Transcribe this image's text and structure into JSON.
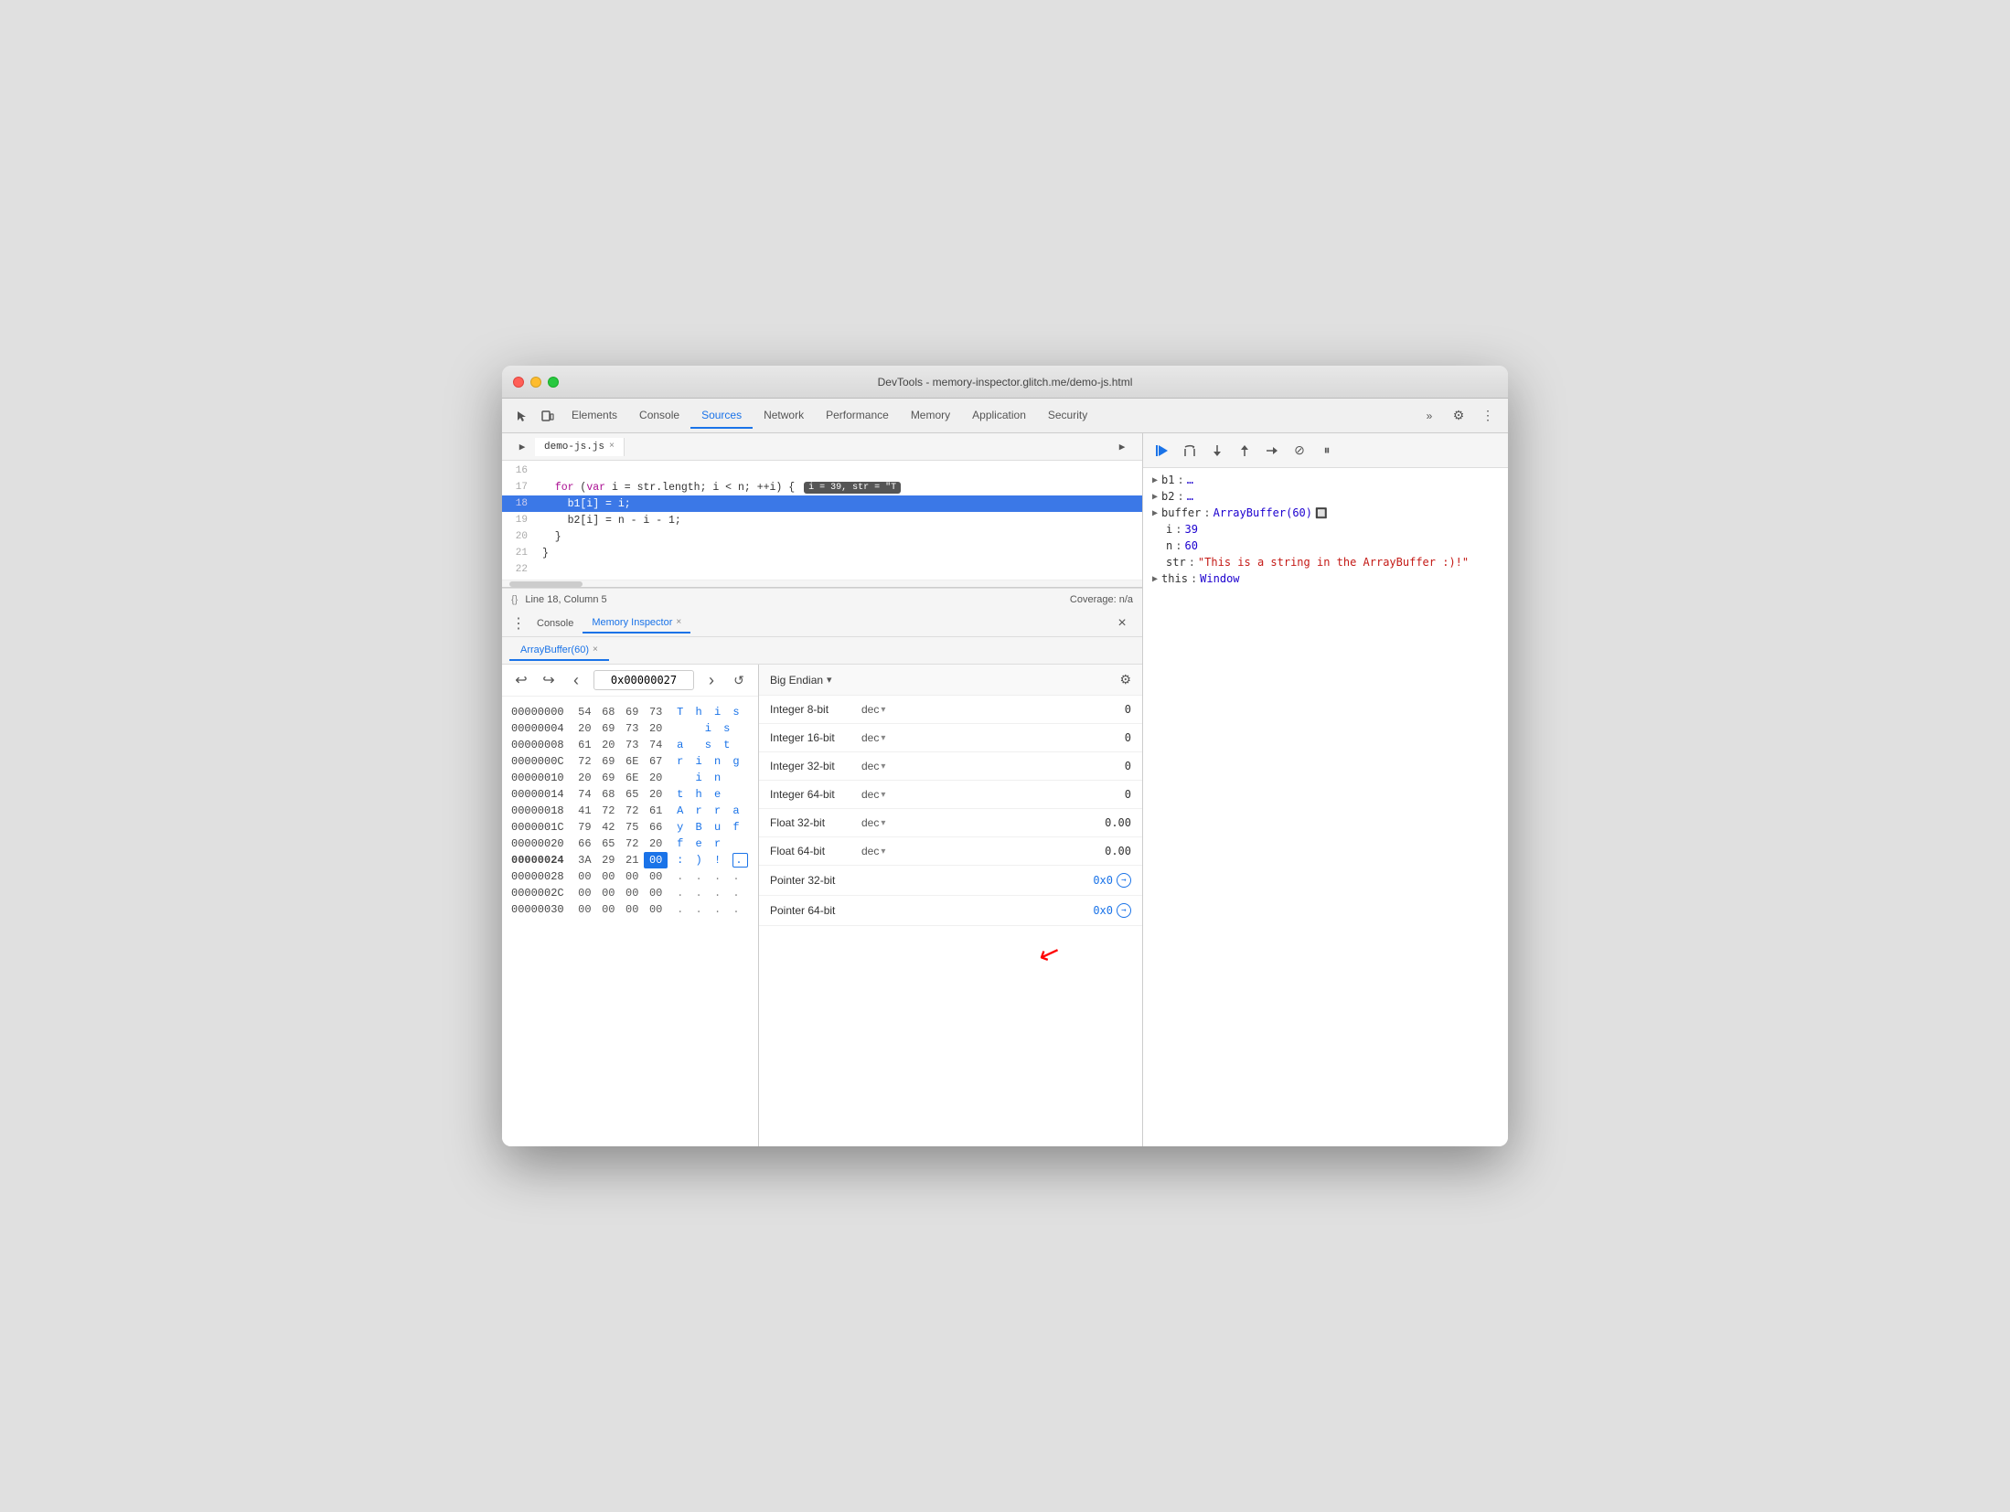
{
  "window": {
    "title": "DevTools - memory-inspector.glitch.me/demo-js.html",
    "traffic_lights": [
      "close",
      "minimize",
      "maximize"
    ]
  },
  "devtools_tabs": {
    "tabs": [
      {
        "label": "Elements",
        "active": false
      },
      {
        "label": "Console",
        "active": false
      },
      {
        "label": "Sources",
        "active": true
      },
      {
        "label": "Network",
        "active": false
      },
      {
        "label": "Performance",
        "active": false
      },
      {
        "label": "Memory",
        "active": false
      },
      {
        "label": "Application",
        "active": false
      },
      {
        "label": "Security",
        "active": false
      }
    ],
    "more_icon": "»",
    "settings_icon": "⚙",
    "menu_icon": "⋮"
  },
  "code_editor": {
    "file_tab": "demo-js.js",
    "lines": [
      {
        "num": "16",
        "text": ""
      },
      {
        "num": "17",
        "text": "  for (var i = str.length; i < n; ++i) {",
        "badge": "i = 39, str = \"T"
      },
      {
        "num": "18",
        "text": "    b1[i] = i;",
        "highlighted": true
      },
      {
        "num": "19",
        "text": "    b2[i] = n - i - 1;"
      },
      {
        "num": "20",
        "text": "  }"
      },
      {
        "num": "21",
        "text": "}"
      },
      {
        "num": "22",
        "text": ""
      }
    ],
    "status": "Line 18, Column 5",
    "coverage": "Coverage: n/a"
  },
  "debugger_toolbar": {
    "buttons": [
      {
        "name": "resume",
        "icon": "▶"
      },
      {
        "name": "step-over",
        "icon": "↪"
      },
      {
        "name": "step-into",
        "icon": "↓"
      },
      {
        "name": "step-out",
        "icon": "↑"
      },
      {
        "name": "step",
        "icon": "→"
      },
      {
        "name": "deactivate",
        "icon": "⊘"
      },
      {
        "name": "pause-exceptions",
        "icon": "⏸"
      }
    ]
  },
  "scope_panel": {
    "items": [
      {
        "key": "b1",
        "value": "…",
        "arrow": "▶",
        "indent": 0
      },
      {
        "key": "b2",
        "value": "…",
        "arrow": "▶",
        "indent": 0
      },
      {
        "key": "buffer",
        "value": "ArrayBuffer(60)",
        "arrow": "▶",
        "indent": 0,
        "has_icon": true
      },
      {
        "key": "i",
        "value": "39",
        "indent": 0,
        "no_arrow": true
      },
      {
        "key": "n",
        "value": "60",
        "indent": 0,
        "no_arrow": true
      },
      {
        "key": "str",
        "value": "\"This is a string in the ArrayBuffer :)!\"",
        "indent": 0,
        "no_arrow": true,
        "is_string": true
      },
      {
        "key": "this",
        "value": "Window",
        "arrow": "▶",
        "indent": 0
      }
    ]
  },
  "bottom_tabs": {
    "tabs": [
      {
        "label": "Console",
        "active": false
      },
      {
        "label": "Memory Inspector",
        "active": true,
        "closeable": true
      }
    ]
  },
  "memory_subtabs": {
    "tabs": [
      {
        "label": "ArrayBuffer(60)",
        "active": true,
        "closeable": true
      }
    ]
  },
  "hex_toolbar": {
    "back_icon": "‹",
    "forward_icon": "›",
    "address": "0x00000027",
    "refresh_icon": "↺",
    "undo_icon": "↩",
    "redo_icon": "↪"
  },
  "hex_rows": [
    {
      "addr": "00000000",
      "bytes": [
        "54",
        "68",
        "69",
        "73"
      ],
      "ascii": "T h i s",
      "bold": false
    },
    {
      "addr": "00000004",
      "bytes": [
        "20",
        "69",
        "73",
        "20"
      ],
      "ascii": "  i s",
      "bold": false
    },
    {
      "addr": "00000008",
      "bytes": [
        "61",
        "20",
        "73",
        "74"
      ],
      "ascii": "a   s t",
      "bold": false
    },
    {
      "addr": "0000000C",
      "bytes": [
        "72",
        "69",
        "6E",
        "67"
      ],
      "ascii": "r i n g",
      "bold": false
    },
    {
      "addr": "00000010",
      "bytes": [
        "20",
        "69",
        "6E",
        "20"
      ],
      "ascii": "  i n  ",
      "bold": false
    },
    {
      "addr": "00000014",
      "bytes": [
        "74",
        "68",
        "65",
        "20"
      ],
      "ascii": "t h e  ",
      "bold": false
    },
    {
      "addr": "00000018",
      "bytes": [
        "41",
        "72",
        "72",
        "61"
      ],
      "ascii": "A r r a",
      "bold": false
    },
    {
      "addr": "0000001C",
      "bytes": [
        "79",
        "42",
        "75",
        "66"
      ],
      "ascii": "y B u f",
      "bold": false
    },
    {
      "addr": "00000020",
      "bytes": [
        "66",
        "65",
        "72",
        "20"
      ],
      "ascii": "f e r  ",
      "bold": false
    },
    {
      "addr": "00000024",
      "bytes": [
        "3A",
        "29",
        "21",
        "00"
      ],
      "ascii": ": ) ! .",
      "bold": true,
      "selected_byte": 3
    },
    {
      "addr": "00000028",
      "bytes": [
        "00",
        "00",
        "00",
        "00"
      ],
      "ascii": ". . . .",
      "bold": false
    },
    {
      "addr": "0000002C",
      "bytes": [
        "00",
        "00",
        "00",
        "00"
      ],
      "ascii": ". . . .",
      "bold": false
    },
    {
      "addr": "00000030",
      "bytes": [
        "00",
        "00",
        "00",
        "00"
      ],
      "ascii": ". . . .",
      "bold": false
    }
  ],
  "data_inspector": {
    "endian": "Big Endian",
    "rows": [
      {
        "label": "Integer 8-bit",
        "format": "dec",
        "value": "0"
      },
      {
        "label": "Integer 16-bit",
        "format": "dec",
        "value": "0"
      },
      {
        "label": "Integer 32-bit",
        "format": "dec",
        "value": "0"
      },
      {
        "label": "Integer 64-bit",
        "format": "dec",
        "value": "0"
      },
      {
        "label": "Float 32-bit",
        "format": "dec",
        "value": "0.00"
      },
      {
        "label": "Float 64-bit",
        "format": "dec",
        "value": "0.00"
      },
      {
        "label": "Pointer 32-bit",
        "format": "",
        "value": "0x0",
        "is_link": true
      },
      {
        "label": "Pointer 64-bit",
        "format": "",
        "value": "0x0",
        "is_link": true
      }
    ]
  }
}
